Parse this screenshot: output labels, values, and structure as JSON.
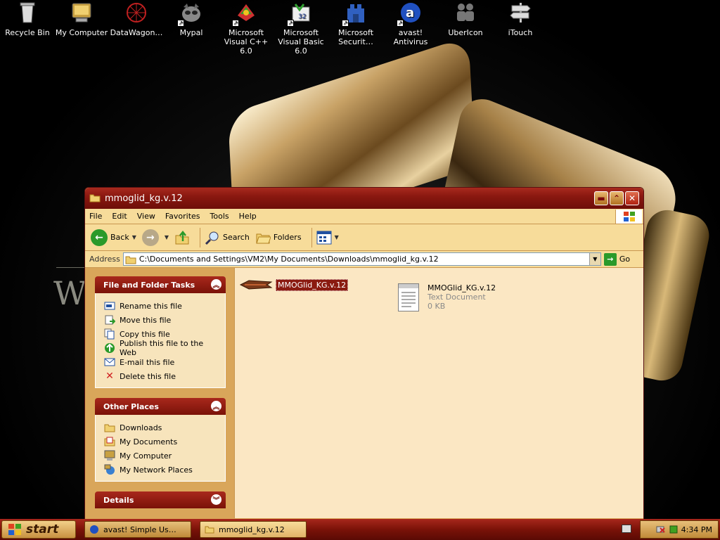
{
  "desktop": {
    "icons": [
      {
        "label": "Recycle Bin",
        "icon": "recycle-bin-icon"
      },
      {
        "label": "My Computer",
        "icon": "my-computer-icon"
      },
      {
        "label": "DataWagon…",
        "icon": "datawagon-icon"
      },
      {
        "label": "Mypal",
        "icon": "mypal-icon"
      },
      {
        "label": "Microsoft Visual C++ 6.0",
        "icon": "visual-cpp-icon"
      },
      {
        "label": "Microsoft Visual Basic 6.0",
        "icon": "visual-basic-icon"
      },
      {
        "label": "Microsoft Securit…",
        "icon": "ms-security-icon"
      },
      {
        "label": "avast! Antivirus",
        "icon": "avast-icon"
      },
      {
        "label": "UberIcon",
        "icon": "ubericon-icon"
      },
      {
        "label": "iTouch",
        "icon": "itouch-icon"
      }
    ],
    "wallpaper_letter": "W"
  },
  "window": {
    "title": "mmoglid_kg.v.12",
    "menu": [
      "File",
      "Edit",
      "View",
      "Favorites",
      "Tools",
      "Help"
    ],
    "toolbar": {
      "back_label": "Back",
      "search_label": "Search",
      "folders_label": "Folders"
    },
    "address": {
      "label": "Address",
      "value": "C:\\Documents and Settings\\VM2\\My Documents\\Downloads\\mmoglid_kg.v.12",
      "go_label": "Go"
    },
    "tasks_panel": {
      "title": "File and Folder Tasks",
      "items": [
        {
          "label": "Rename this file",
          "icon": "rename-icon"
        },
        {
          "label": "Move this file",
          "icon": "move-icon"
        },
        {
          "label": "Copy this file",
          "icon": "copy-icon"
        },
        {
          "label": "Publish this file to the Web",
          "icon": "publish-web-icon"
        },
        {
          "label": "E-mail this file",
          "icon": "email-icon"
        },
        {
          "label": "Delete this file",
          "icon": "delete-icon"
        }
      ]
    },
    "places_panel": {
      "title": "Other Places",
      "items": [
        {
          "label": "Downloads",
          "icon": "folder-icon"
        },
        {
          "label": "My Documents",
          "icon": "my-documents-icon"
        },
        {
          "label": "My Computer",
          "icon": "my-computer-icon"
        },
        {
          "label": "My Network Places",
          "icon": "network-places-icon"
        }
      ]
    },
    "details_panel": {
      "title": "Details"
    },
    "files": [
      {
        "name": "MMOGlid_KG.v.12",
        "selected": true
      },
      {
        "name": "MMOGlid_KG.v.12",
        "type": "Text Document",
        "size": "0 KB"
      }
    ]
  },
  "taskbar": {
    "start_label": "start",
    "tasks": [
      {
        "label": "avast! Simple Us…",
        "icon": "avast-icon"
      },
      {
        "label": "mmoglid_kg.v.12",
        "icon": "folder-icon"
      }
    ],
    "clock": "4:34 PM"
  },
  "colors": {
    "title_red": "#8a1810",
    "accent_gold": "#d9a65a",
    "content_bg": "#fbe7c3"
  }
}
